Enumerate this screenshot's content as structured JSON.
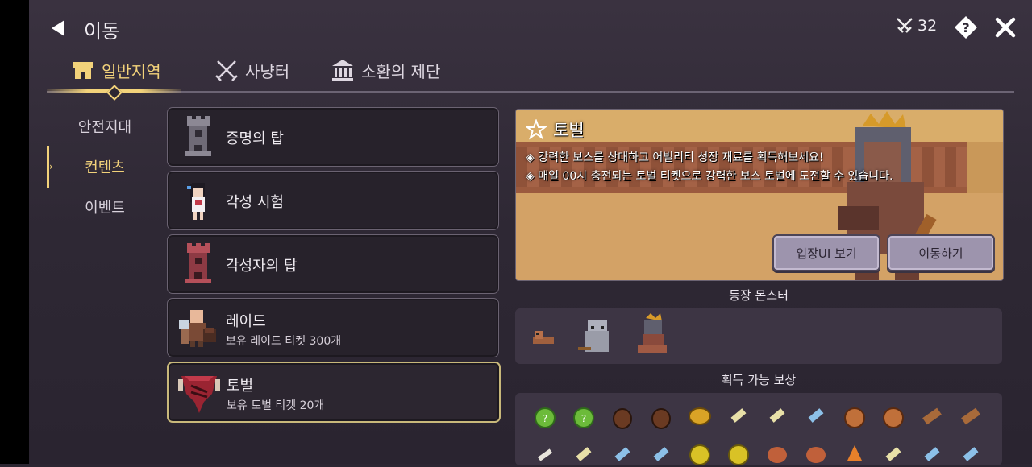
{
  "header": {
    "title": "이동",
    "ticket_count": "32"
  },
  "tabs": [
    {
      "label": "일반지역",
      "icon": "shop-icon",
      "active": true
    },
    {
      "label": "사냥터",
      "icon": "crossed-swords-icon",
      "active": false
    },
    {
      "label": "소환의 제단",
      "icon": "temple-icon",
      "active": false
    }
  ],
  "side_menu": [
    {
      "label": "안전지대",
      "active": false
    },
    {
      "label": "컨텐츠",
      "active": true
    },
    {
      "label": "이벤트",
      "active": false
    }
  ],
  "content_list": [
    {
      "name": "증명의 탑",
      "sub": ""
    },
    {
      "name": "각성 시험",
      "sub": ""
    },
    {
      "name": "각성자의 탑",
      "sub": ""
    },
    {
      "name": "레이드",
      "sub": "보유 레이드 티켓 300개"
    },
    {
      "name": "토벌",
      "sub": "보유 토벌 티켓 20개"
    }
  ],
  "detail": {
    "title": "토벌",
    "desc_1": "◈ 강력한 보스를 상대하고 어빌리티 성장 재료를 획득해보세요!",
    "desc_2": "◈ 매일 00시 충전되는 토벌 티켓으로 강력한 보스 토벌에 도전할 수 있습니다.",
    "enter_ui_button": "입장UI 보기",
    "move_button": "이동하기",
    "monsters_label": "등장 몬스터",
    "rewards_label": "획득 가능 보상"
  },
  "colors": {
    "accent": "#f2d27a",
    "panel": "#3d3544",
    "banner_sand": "#d3a266"
  }
}
